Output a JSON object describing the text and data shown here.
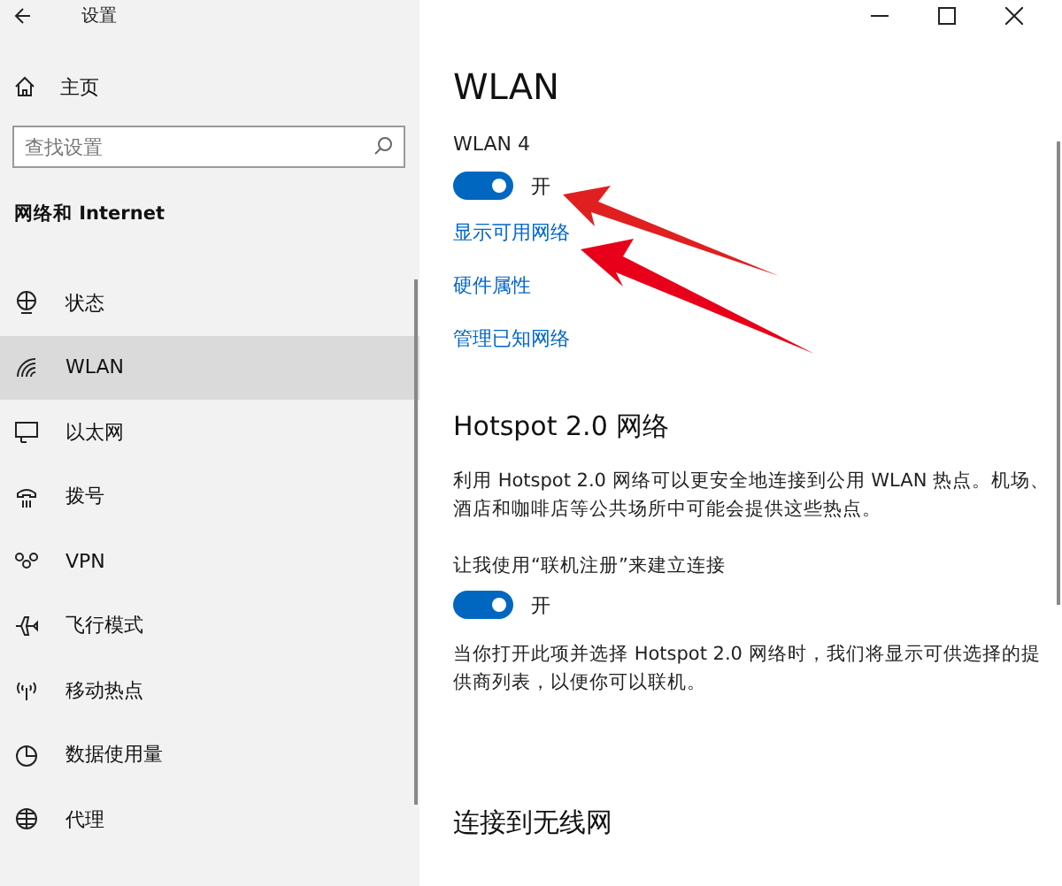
{
  "window": {
    "title": "设置"
  },
  "sidebar": {
    "home": "主页",
    "search": {
      "placeholder": "查找设置"
    },
    "section": "网络和 Internet",
    "items": [
      {
        "label": "状态",
        "selected": false
      },
      {
        "label": "WLAN",
        "selected": true
      },
      {
        "label": "以太网",
        "selected": false
      },
      {
        "label": "拨号",
        "selected": false
      },
      {
        "label": "VPN",
        "selected": false
      },
      {
        "label": "飞行模式",
        "selected": false
      },
      {
        "label": "移动热点",
        "selected": false
      },
      {
        "label": "数据使用量",
        "selected": false
      },
      {
        "label": "代理",
        "selected": false
      }
    ]
  },
  "main": {
    "title": "WLAN",
    "adapter": "WLAN 4",
    "wlan_toggle": {
      "on": true,
      "label": "开"
    },
    "links": [
      "显示可用网络",
      "硬件属性",
      "管理已知网络"
    ],
    "hotspot": {
      "heading": "Hotspot 2.0 网络",
      "description": "利用 Hotspot 2.0 网络可以更安全地连接到公用 WLAN 热点。机场、酒店和咖啡店等公共场所中可能会提供这些热点。",
      "option": "让我使用“联机注册”来建立连接",
      "toggle": {
        "on": true,
        "label": "开"
      },
      "note": "当你打开此项并选择 Hotspot 2.0 网络时，我们将显示可供选择的提供商列表，以便你可以联机。"
    },
    "next_heading": "连接到无线网"
  }
}
